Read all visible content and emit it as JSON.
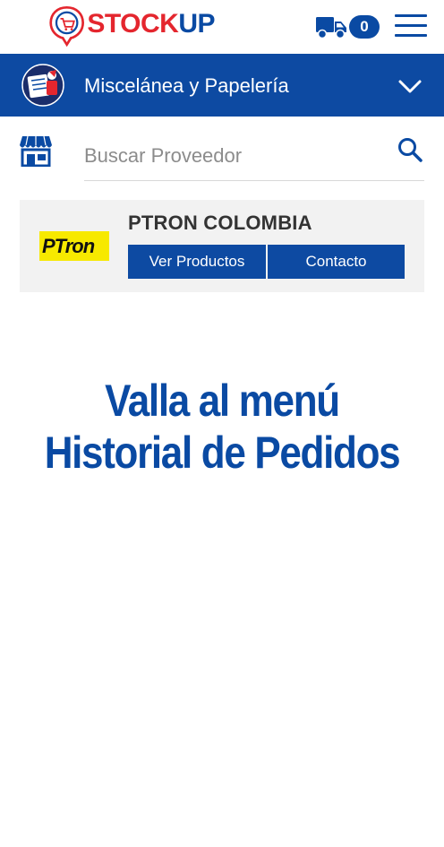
{
  "app": {
    "logo_stock": "STOCK",
    "logo_up": "UP"
  },
  "header": {
    "cart_count": "0",
    "icons": [
      "logo-mark-icon",
      "truck-icon",
      "hamburger-menu-icon"
    ]
  },
  "category": {
    "label": "Miscelánea y Papelería",
    "icons": [
      "stationery-icon",
      "chevron-down-icon"
    ]
  },
  "search": {
    "placeholder": "Buscar Proveedor",
    "icons": [
      "store-icon",
      "search-icon"
    ]
  },
  "supplier": {
    "logo_text": "PTron",
    "name": "PTRON COLOMBIA",
    "view_products_label": "Ver Productos",
    "contact_label": "Contacto"
  },
  "instruction": {
    "line1": "Valla al menú",
    "line2": "Historial de Pedidos"
  },
  "colors": {
    "brand_blue": "#0d4aa2",
    "brand_red": "#e4262e",
    "logo_yellow": "#f7e900",
    "card_bg": "#f2f2f2"
  }
}
